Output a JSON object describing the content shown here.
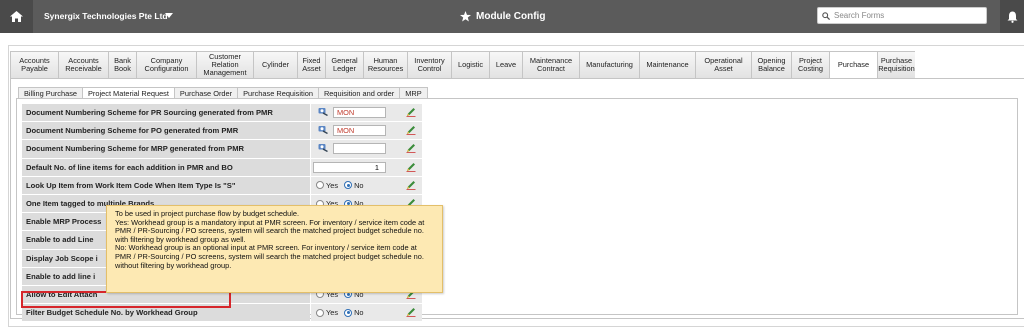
{
  "header": {
    "company": "Synergix Technologies Pte Ltd",
    "title": "Module Config",
    "search_placeholder": "Search Forms"
  },
  "main_tabs": [
    {
      "label": "Accounts Payable",
      "w": 48
    },
    {
      "label": "Accounts Receivable",
      "w": 50
    },
    {
      "label": "Bank Book",
      "w": 28
    },
    {
      "label": "Company Configuration",
      "w": 60
    },
    {
      "label": "Customer Relation Management",
      "w": 57
    },
    {
      "label": "Cylinder",
      "w": 44
    },
    {
      "label": "Fixed Asset",
      "w": 28
    },
    {
      "label": "General Ledger",
      "w": 38
    },
    {
      "label": "Human Resources",
      "w": 44
    },
    {
      "label": "Inventory Control",
      "w": 44
    },
    {
      "label": "Logistic",
      "w": 38
    },
    {
      "label": "Leave",
      "w": 33
    },
    {
      "label": "Maintenance Contract",
      "w": 57
    },
    {
      "label": "Manufacturing",
      "w": 60
    },
    {
      "label": "Maintenance",
      "w": 56
    },
    {
      "label": "Operational Asset",
      "w": 56
    },
    {
      "label": "Opening Balance",
      "w": 40
    },
    {
      "label": "Project Costing",
      "w": 38
    },
    {
      "label": "Purchase",
      "w": 48,
      "active": true
    },
    {
      "label": "Purchase Requisition",
      "w": 38
    }
  ],
  "sub_tabs": [
    {
      "label": "Billing Purchase"
    },
    {
      "label": "Project Material Request",
      "active": true
    },
    {
      "label": "Purchase Order"
    },
    {
      "label": "Purchase Requisition"
    },
    {
      "label": "Requisition and order"
    },
    {
      "label": "MRP"
    }
  ],
  "settings": [
    {
      "label": "Document Numbering Scheme for PR Sourcing generated from PMR",
      "type": "scheme",
      "value": "MON"
    },
    {
      "label": "Document Numbering Scheme for PO generated from PMR",
      "type": "scheme",
      "value": "MON"
    },
    {
      "label": "Document Numbering Scheme for MRP generated from PMR",
      "type": "scheme",
      "value": ""
    },
    {
      "label": "Default No. of line items for each addition in PMR and BO",
      "type": "number",
      "value": "1"
    },
    {
      "label": "Look Up Item from Work Item Code When Item Type Is \"S\"",
      "type": "radio",
      "value": "No"
    },
    {
      "label": "One Item tagged to multiple Brands",
      "type": "radio",
      "value": "No"
    },
    {
      "label": "Enable MRP Process",
      "type": "radio",
      "value": "No"
    },
    {
      "label": "Enable to add Line",
      "type": "radio",
      "value": "No"
    },
    {
      "label": "Display Job Scope i",
      "type": "radio",
      "value": "No"
    },
    {
      "label": "Enable to add line i",
      "type": "radio",
      "value": "No"
    },
    {
      "label": "Allow to Edit Attach",
      "type": "radio",
      "value": "No"
    },
    {
      "label": "Filter Budget Schedule No. by Workhead Group",
      "type": "radio",
      "value": "No"
    }
  ],
  "radio_labels": {
    "yes": "Yes",
    "no": "No"
  },
  "tooltip": {
    "text": "To be used in project purchase flow by budget schedule.\nYes: Workhead group is a mandatory input at PMR screen. For inventory / service item code at PMR / PR-Sourcing / PO screens, system will search the matched project budget schedule no. with filtering by workhead group as well.\nNo: Workhead group is an optional input at PMR screen. For inventory / service item code at PMR / PR-Sourcing / PO screens, system will search the matched project budget schedule no. without filtering by workhead group."
  }
}
